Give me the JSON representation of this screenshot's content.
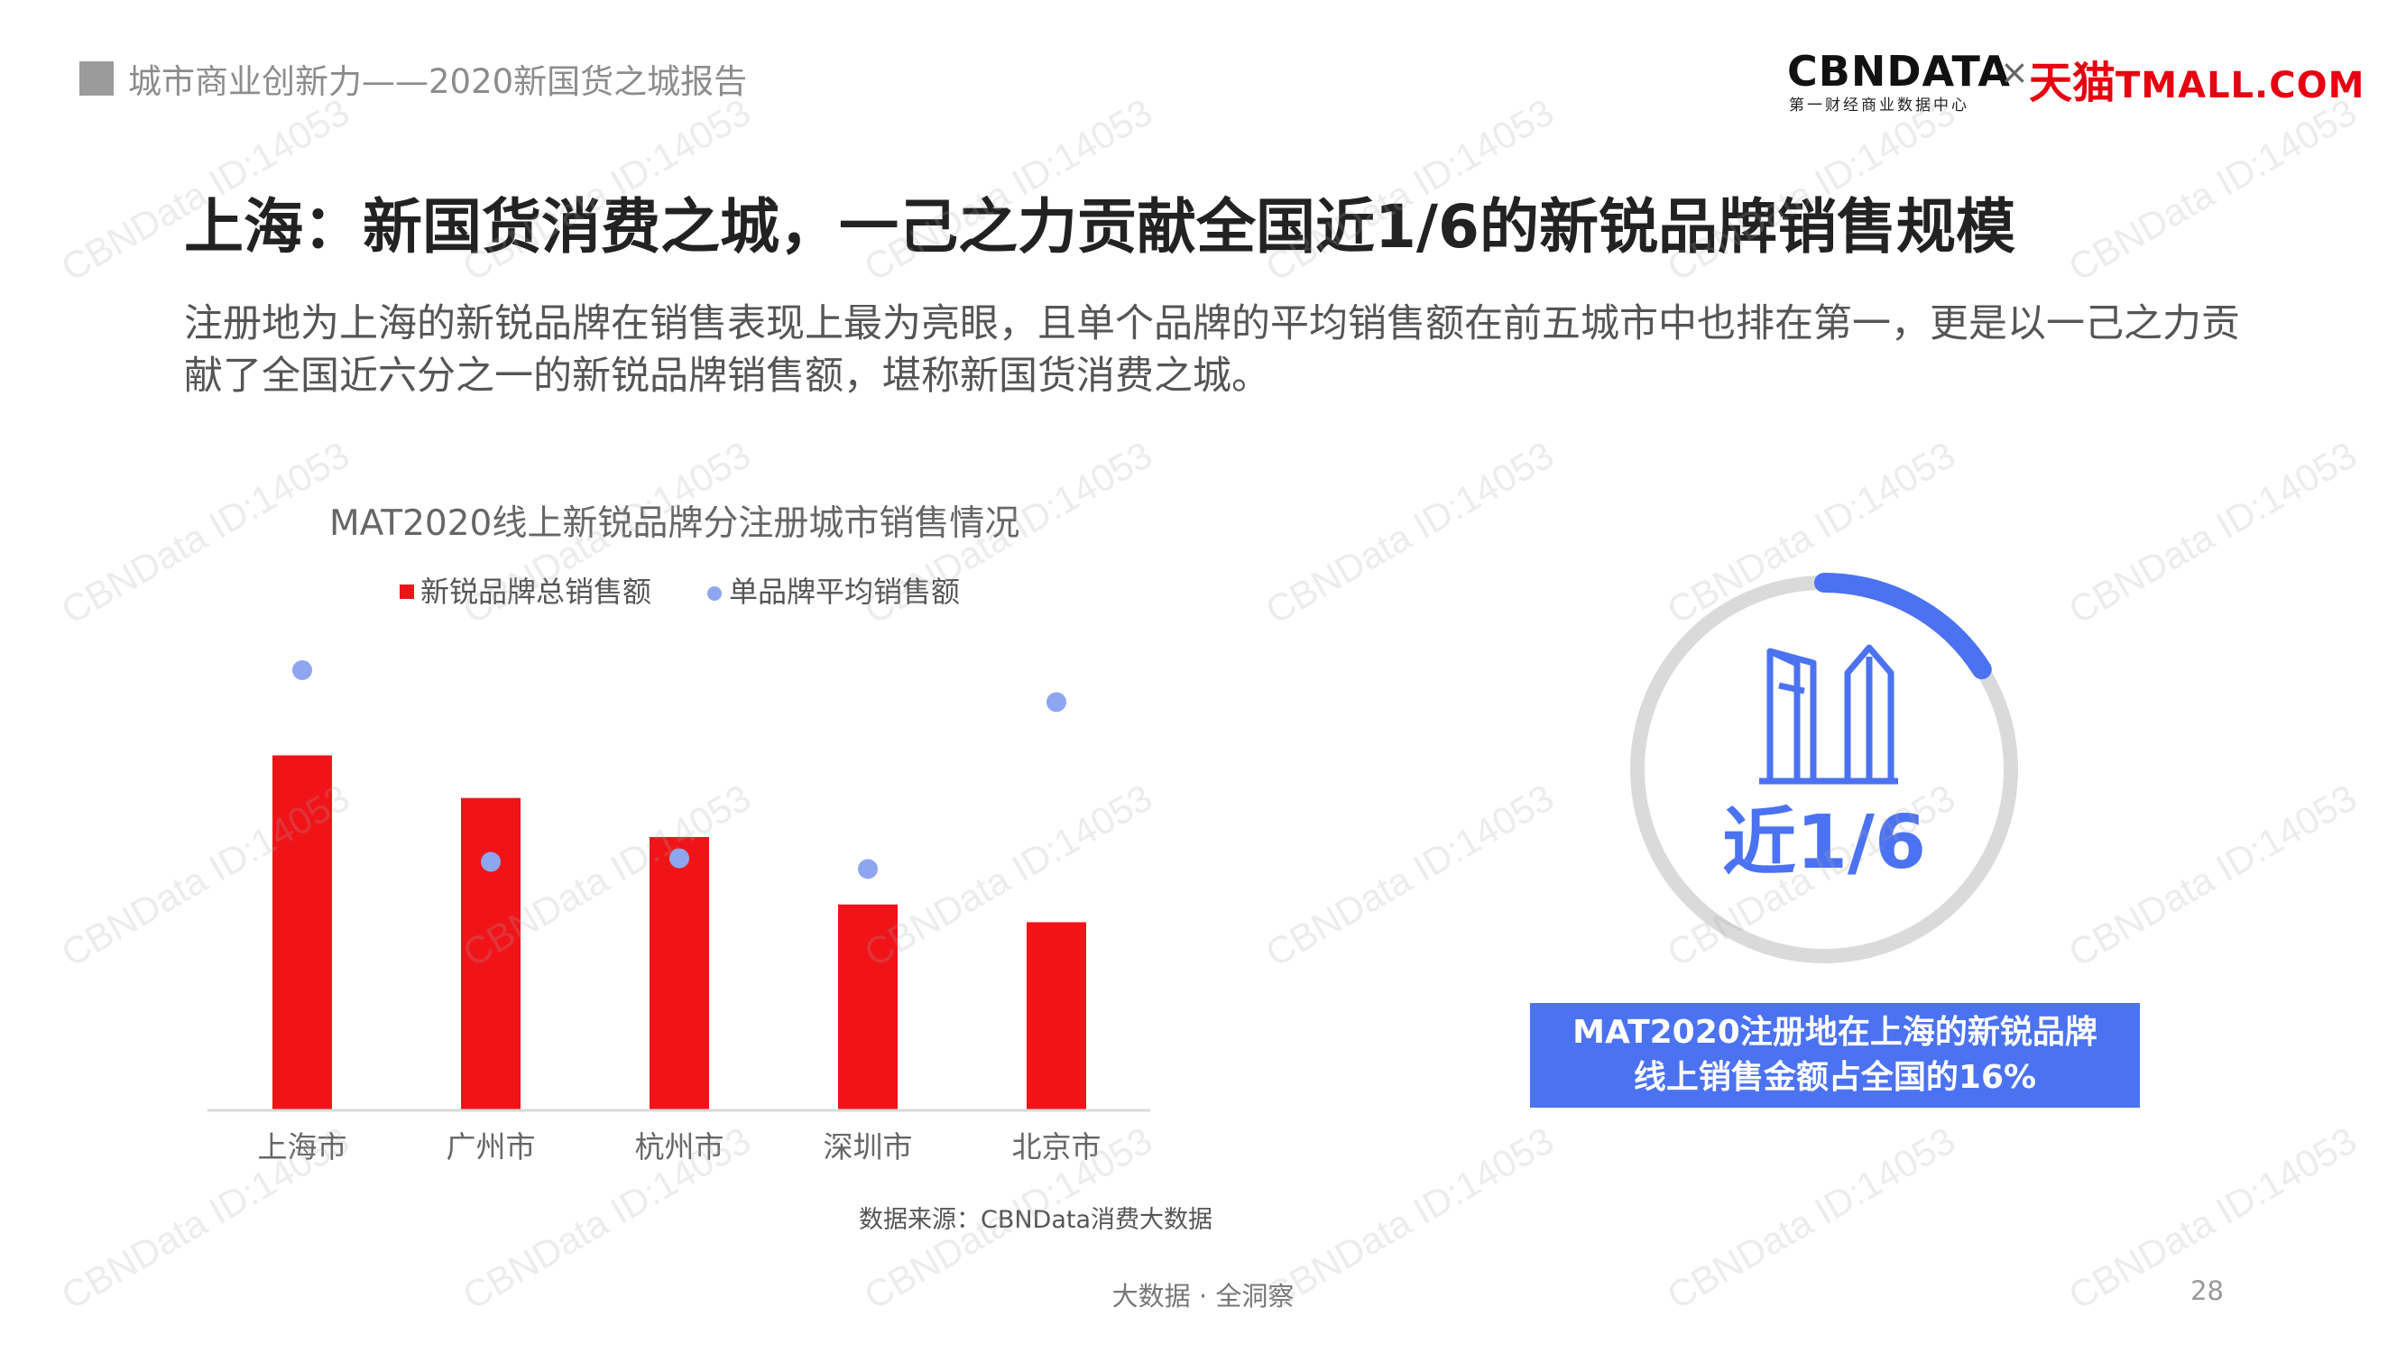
{
  "header": {
    "breadcrumb": "城市商业创新力——2020新国货之城报告"
  },
  "logos": {
    "cbndata": "CBNDATA",
    "cbndata_sub": "第一财经商业数据中心",
    "separator": "×",
    "tmall_cn": "天猫",
    "tmall_en": "TMALL.COM"
  },
  "title": "上海：新国货消费之城，一己之力贡献全国近1/6的新锐品牌销售规模",
  "description": "注册地为上海的新锐品牌在销售表现上最为亮眼，且单个品牌的平均销售额在前五城市中也排在第一，更是以一己之力贡献了全国近六分之一的新锐品牌销售额，堪称新国货消费之城。",
  "chart_data": {
    "type": "bar",
    "title": "MAT2020线上新锐品牌分注册城市销售情况",
    "categories": [
      "上海市",
      "广州市",
      "杭州市",
      "深圳市",
      "北京市"
    ],
    "series": [
      {
        "name": "新锐品牌总销售额",
        "type": "bar",
        "color": "#f01419",
        "values": [
          100,
          88,
          77,
          58,
          53
        ]
      },
      {
        "name": "单品牌平均销售额",
        "type": "scatter",
        "color": "#8ea6f0",
        "values": [
          124,
          70,
          71,
          68,
          115
        ]
      }
    ],
    "ylim": [
      0,
      140
    ],
    "grid": false,
    "legend_position": "top",
    "source": "数据来源：CBNData消费大数据"
  },
  "highlight": {
    "value_text": "近1/6",
    "fraction": 0.16,
    "ring_color": "#4b72f0",
    "ring_track_color": "#d9d9d9",
    "icon": "skyscraper-icon",
    "caption_line1": "MAT2020注册地在上海的新锐品牌",
    "caption_line2": "线上销售金额占全国的16%"
  },
  "footer": {
    "tagline": "大数据 · 全洞察",
    "page_number": "28"
  },
  "watermark": "CBNData ID:14053"
}
